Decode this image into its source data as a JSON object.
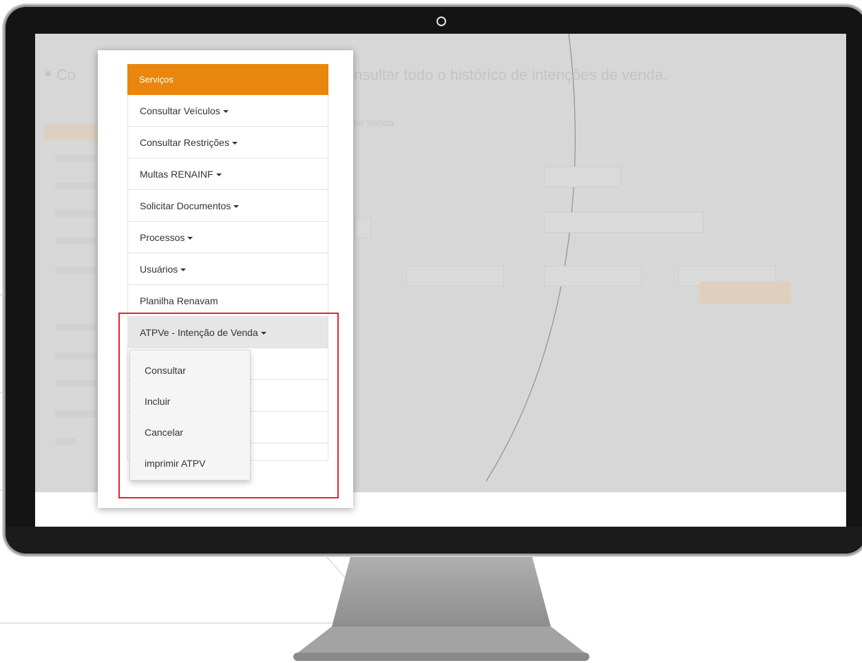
{
  "background_page": {
    "heading": "Co",
    "heading_tail": "onsultar todo o histórico de intenções de venda.",
    "subheading": "de Venda"
  },
  "menu": {
    "header": "Serviços",
    "items": [
      {
        "label": "Consultar Veículos",
        "has_caret": true
      },
      {
        "label": "Consultar Restrições",
        "has_caret": true
      },
      {
        "label": "Multas RENAINF",
        "has_caret": true
      },
      {
        "label": "Solicitar Documentos",
        "has_caret": true
      },
      {
        "label": "Processos",
        "has_caret": true
      },
      {
        "label": "Usuários",
        "has_caret": true
      },
      {
        "label": "Planilha Renavam",
        "has_caret": false
      },
      {
        "label": "ATPVe - Intenção de Venda",
        "has_caret": true,
        "active": true
      }
    ]
  },
  "submenu": {
    "items": [
      "Consultar",
      "Incluir",
      "Cancelar",
      "imprimir ATPV"
    ]
  },
  "colors": {
    "header_orange": "#e8860d",
    "highlight_red": "#e2222e",
    "bezel": "#141414"
  }
}
